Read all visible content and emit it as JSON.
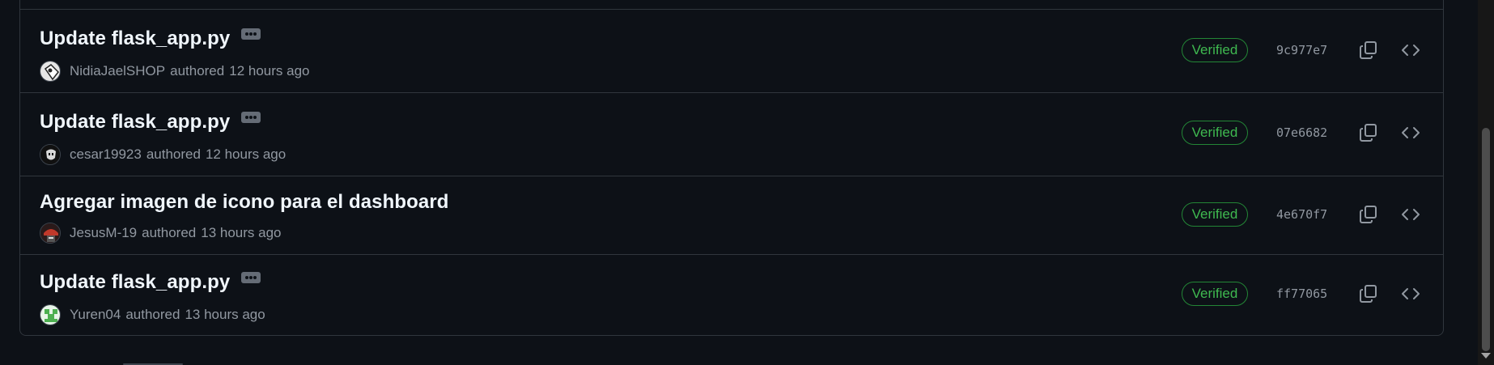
{
  "commits": [
    {
      "title": "Update flask_app.py",
      "has_more_button": true,
      "author": "NidiaJaelSHOP",
      "authored_word": "authored",
      "time": "12 hours ago",
      "avatar_icon": "avatar-icon",
      "verified_label": "Verified",
      "sha": "9c977e7"
    },
    {
      "title": "Update flask_app.py",
      "has_more_button": true,
      "author": "cesar19923",
      "authored_word": "authored",
      "time": "12 hours ago",
      "avatar_icon": "avatar-icon",
      "verified_label": "Verified",
      "sha": "07e6682"
    },
    {
      "title": "Agregar imagen de icono para el dashboard",
      "has_more_button": false,
      "author": "JesusM-19",
      "authored_word": "authored",
      "time": "13 hours ago",
      "avatar_icon": "avatar-icon",
      "verified_label": "Verified",
      "sha": "4e670f7"
    },
    {
      "title": "Update flask_app.py",
      "has_more_button": true,
      "author": "Yuren04",
      "authored_word": "authored",
      "time": "13 hours ago",
      "avatar_icon": "avatar-icon",
      "verified_label": "Verified",
      "sha": "ff77065"
    }
  ],
  "icons": {
    "more": "ellipsis-icon",
    "copy": "copy-icon",
    "browse": "code-icon"
  },
  "colors": {
    "background": "#0d1117",
    "border": "#30363d",
    "title": "#f0f6fc",
    "muted": "#9198a1",
    "verified_green": "#3fb950",
    "verified_border": "#238636"
  }
}
